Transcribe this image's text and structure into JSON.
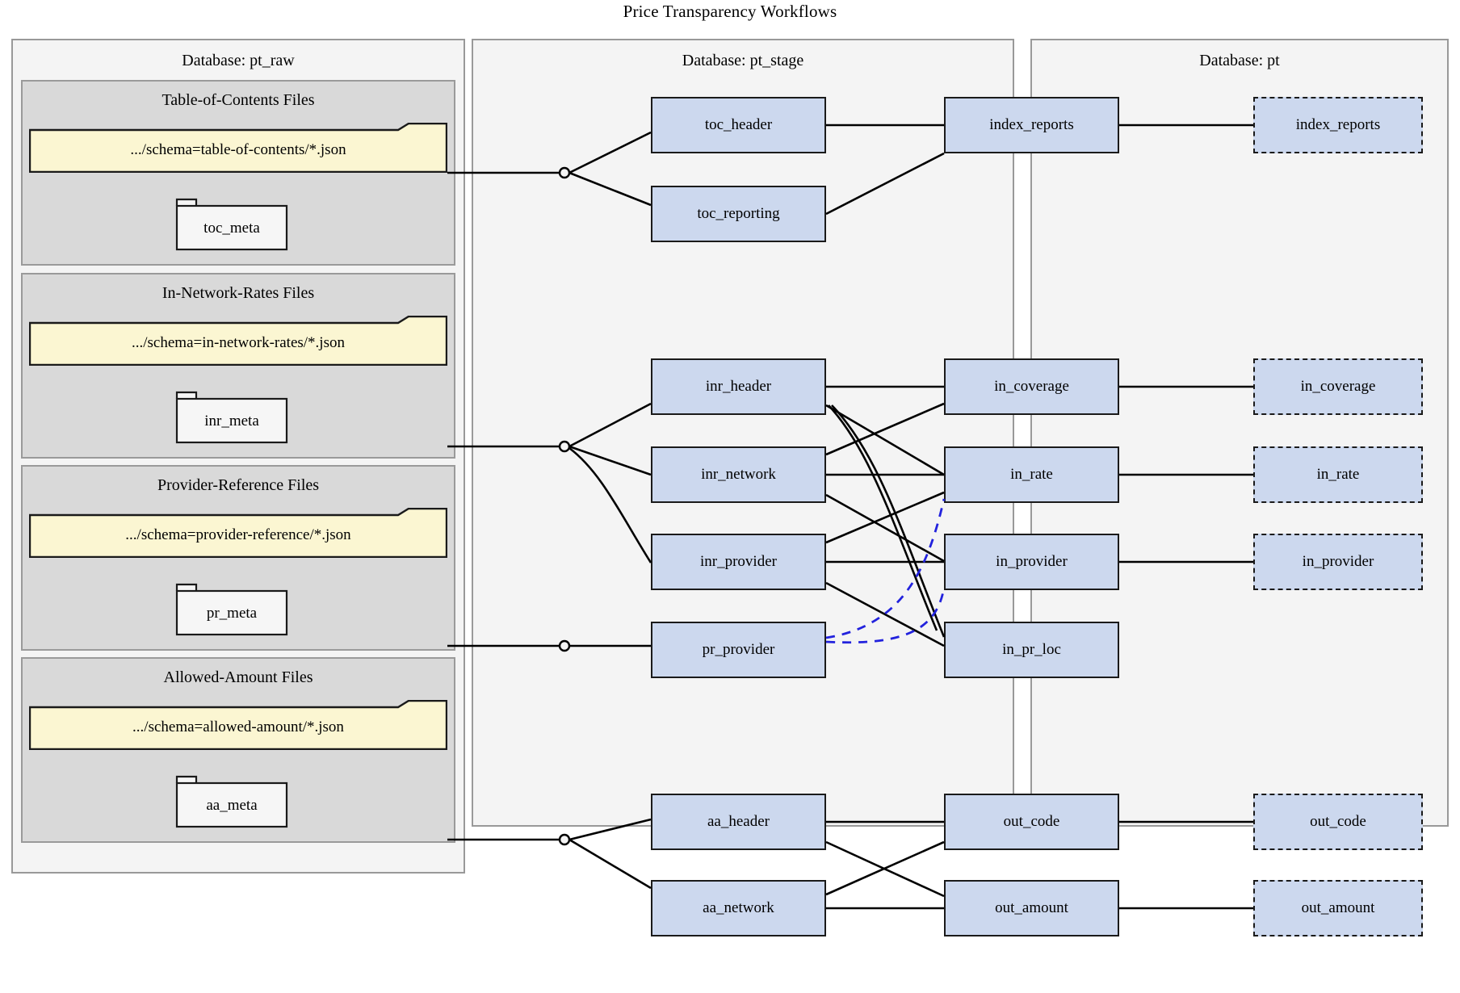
{
  "title": "Price Transparency Workflows",
  "colors": {
    "table_fill": "#ccd8ee",
    "table_border": "#1a1a1a",
    "cluster_fill": "#f4f4f4",
    "cluster_border": "#999999",
    "subcluster_fill": "#d9d9d9",
    "subcluster_border": "#9a9a9a",
    "note_fill": "#fbf6d2",
    "note_border": "#1a1a1a",
    "folder_fill": "#f6f6f6",
    "edge_solid": "#000000",
    "edge_dashed": "#2222dd"
  },
  "clusters": [
    {
      "id": "pt_raw",
      "label": "Database: pt_raw"
    },
    {
      "id": "pt_stage",
      "label": "Database: pt_stage"
    },
    {
      "id": "pt",
      "label": "Database: pt"
    }
  ],
  "subclusters": [
    {
      "id": "toc",
      "label": "Table-of-Contents Files"
    },
    {
      "id": "inr",
      "label": "In-Network-Rates Files"
    },
    {
      "id": "pr",
      "label": "Provider-Reference Files"
    },
    {
      "id": "aa",
      "label": "Allowed-Amount Files"
    }
  ],
  "path_notes": [
    {
      "id": "toc_path",
      "label": ".../schema=table-of-contents/*.json"
    },
    {
      "id": "inr_path",
      "label": ".../schema=in-network-rates/*.json"
    },
    {
      "id": "pr_path",
      "label": ".../schema=provider-reference/*.json"
    },
    {
      "id": "aa_path",
      "label": ".../schema=allowed-amount/*.json"
    }
  ],
  "meta_folders": [
    {
      "id": "toc_meta",
      "label": "toc_meta"
    },
    {
      "id": "inr_meta",
      "label": "inr_meta"
    },
    {
      "id": "pr_meta",
      "label": "pr_meta"
    },
    {
      "id": "aa_meta",
      "label": "aa_meta"
    }
  ],
  "stage_tables": [
    {
      "id": "toc_header",
      "label": "toc_header"
    },
    {
      "id": "toc_reporting",
      "label": "toc_reporting"
    },
    {
      "id": "index_reports",
      "label": "index_reports"
    },
    {
      "id": "inr_header",
      "label": "inr_header"
    },
    {
      "id": "inr_network",
      "label": "inr_network"
    },
    {
      "id": "inr_provider",
      "label": "inr_provider"
    },
    {
      "id": "pr_provider",
      "label": "pr_provider"
    },
    {
      "id": "in_coverage",
      "label": "in_coverage"
    },
    {
      "id": "in_rate",
      "label": "in_rate"
    },
    {
      "id": "in_provider",
      "label": "in_provider"
    },
    {
      "id": "in_pr_loc",
      "label": "in_pr_loc"
    },
    {
      "id": "aa_header",
      "label": "aa_header"
    },
    {
      "id": "aa_network",
      "label": "aa_network"
    },
    {
      "id": "out_code",
      "label": "out_code"
    },
    {
      "id": "out_amount",
      "label": "out_amount"
    }
  ],
  "pt_tables": [
    {
      "id": "pt_index_reports",
      "label": "index_reports"
    },
    {
      "id": "pt_in_coverage",
      "label": "in_coverage"
    },
    {
      "id": "pt_in_rate",
      "label": "in_rate"
    },
    {
      "id": "pt_in_provider",
      "label": "in_provider"
    },
    {
      "id": "pt_out_code",
      "label": "out_code"
    },
    {
      "id": "pt_out_amount",
      "label": "out_amount"
    }
  ]
}
